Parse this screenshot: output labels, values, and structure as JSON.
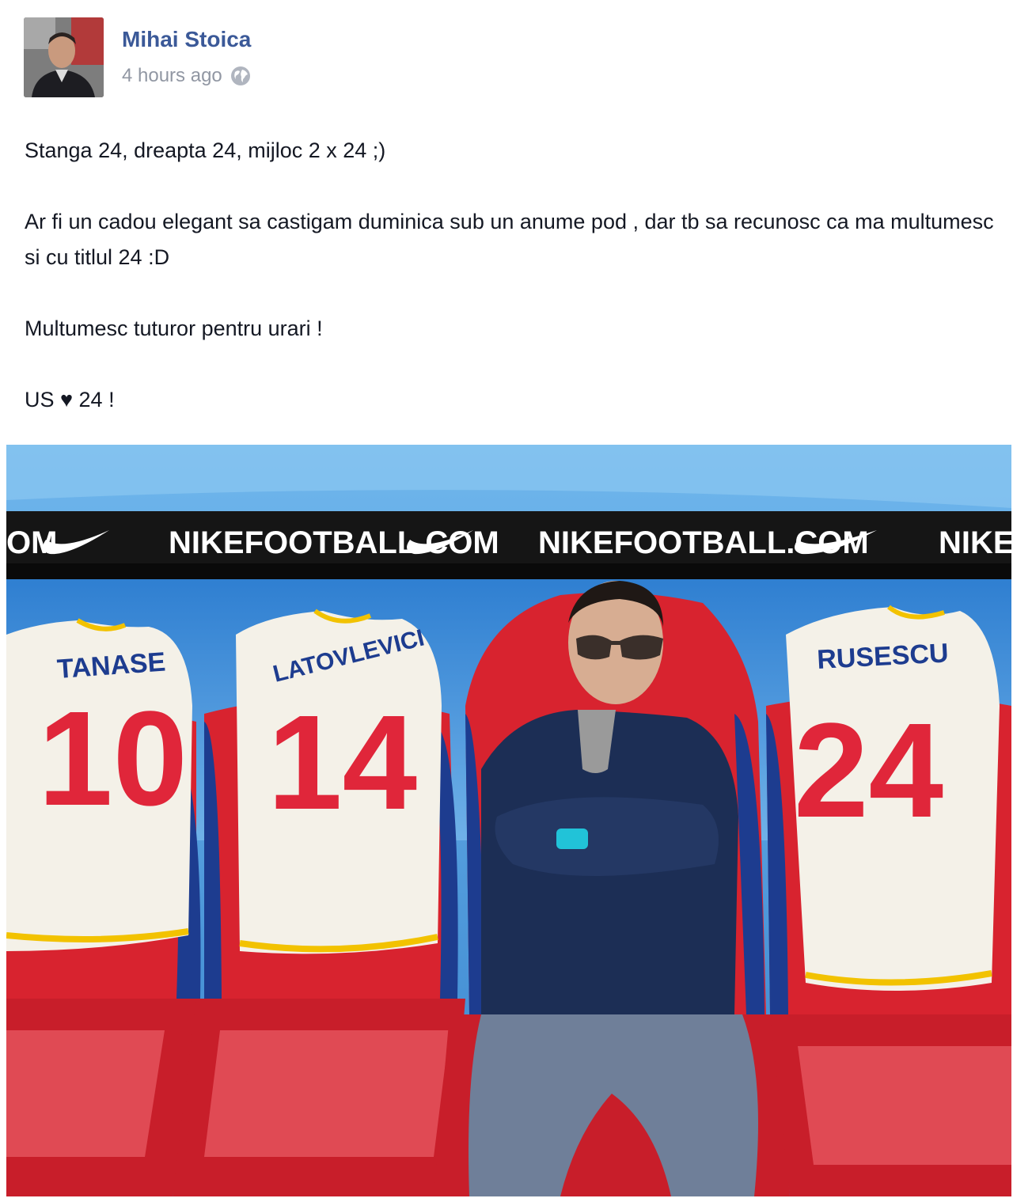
{
  "post": {
    "author": "Mihai Stoica",
    "timestamp": "4 hours ago",
    "privacy_icon": "globe-icon",
    "paragraphs": [
      "Stanga 24, dreapta 24, mijloc 2 x 24 ;)",
      "Ar fi un cadou elegant sa castigam duminica sub un anume pod , dar tb sa recunosc ca ma multumesc si cu titlul 24 :D",
      "Multumesc tuturor pentru urari !",
      "US ♥ 24 !"
    ]
  },
  "photo": {
    "banner_texts": [
      "OM",
      "NIKEFOOTBALL.COM",
      "NIKEFOOTBALL.COM",
      "NIKE"
    ],
    "jerseys": [
      {
        "name": "TANASE",
        "number": "10"
      },
      {
        "name": "LATOVLEVICI",
        "number": "14"
      },
      {
        "name": "RUSESCU",
        "number": "24"
      }
    ]
  },
  "colors": {
    "link": "#3b5998",
    "meta": "#9197a3",
    "seat_red": "#d8232f",
    "seat_blue": "#1d3c8f",
    "sky_blue": "#4f9fe0"
  }
}
